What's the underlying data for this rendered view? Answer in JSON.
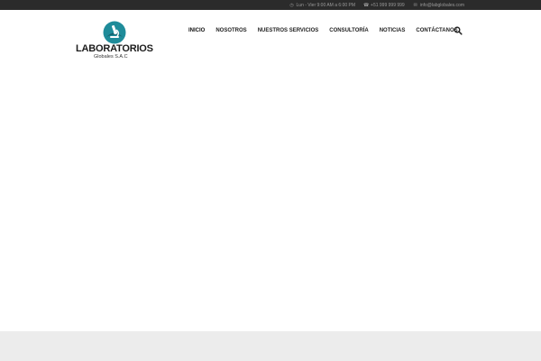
{
  "topbar": {
    "hours": "Lun - Vier 9:00 AM a 6:00 PM",
    "phone": "+51 999 999 999",
    "email": "info@labglobales.com"
  },
  "logo": {
    "title": "LABORATORIOS",
    "subtitle": "Globales S.A.C"
  },
  "nav": {
    "items": [
      {
        "label": "INICIO"
      },
      {
        "label": "NOSOTROS"
      },
      {
        "label": "NUESTROS SERVICIOS"
      },
      {
        "label": "CONSULTORÍA"
      },
      {
        "label": "NOTICIAS"
      },
      {
        "label": "CONTÁCTANOS"
      }
    ],
    "search_icon": "search-icon"
  },
  "colors": {
    "topbar_bg": "#2b2b2b",
    "logo_teal": "#1f8c9a",
    "footer_band": "#ececec"
  }
}
